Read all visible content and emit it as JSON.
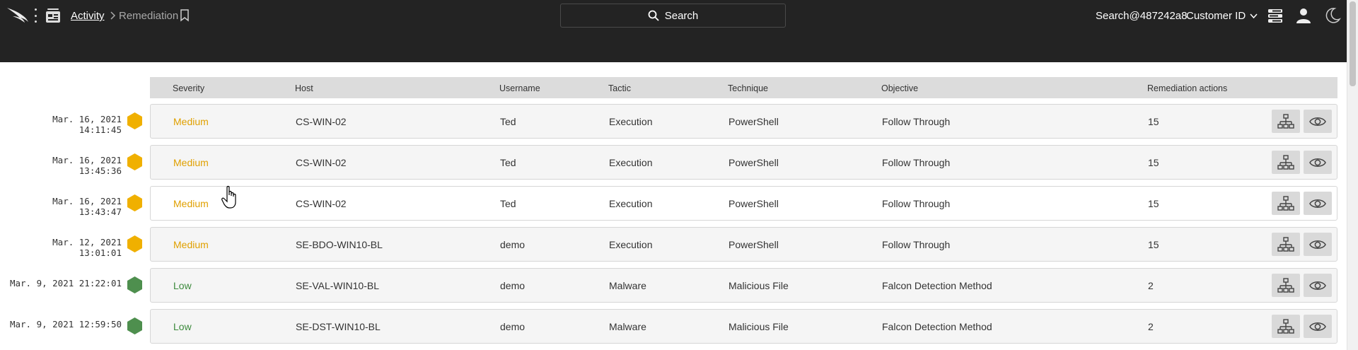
{
  "breadcrumb": {
    "parent": "Activity",
    "current": "Remediation"
  },
  "search": {
    "label": "Search"
  },
  "header": {
    "user": "Search@487242a8",
    "customer": "Customer ID"
  },
  "icons": {
    "logo": "falcon-logo-icon",
    "menu": "vertical-dots-icon",
    "app": "activity-app-icon",
    "bookmark": "bookmark-icon",
    "search": "search-icon",
    "dashboard": "dashboard-icon",
    "profile": "user-icon",
    "theme": "moon-icon",
    "graph": "process-tree-icon",
    "view": "eye-icon"
  },
  "colors": {
    "medium": "#f0b000",
    "low": "#4e8f4e",
    "topbar": "#232323"
  },
  "table": {
    "columns": [
      "Severity",
      "Host",
      "Username",
      "Tactic",
      "Technique",
      "Objective",
      "Remediation actions"
    ],
    "rows": [
      {
        "timestamp": "Mar. 16, 2021 14:11:45",
        "severity": "Medium",
        "host": "CS-WIN-02",
        "username": "Ted",
        "tactic": "Execution",
        "technique": "PowerShell",
        "objective": "Follow Through",
        "actions": "15"
      },
      {
        "timestamp": "Mar. 16, 2021 13:45:36",
        "severity": "Medium",
        "host": "CS-WIN-02",
        "username": "Ted",
        "tactic": "Execution",
        "technique": "PowerShell",
        "objective": "Follow Through",
        "actions": "15"
      },
      {
        "timestamp": "Mar. 16, 2021 13:43:47",
        "severity": "Medium",
        "host": "CS-WIN-02",
        "username": "Ted",
        "tactic": "Execution",
        "technique": "PowerShell",
        "objective": "Follow Through",
        "actions": "15"
      },
      {
        "timestamp": "Mar. 12, 2021 13:01:01",
        "severity": "Medium",
        "host": "SE-BDO-WIN10-BL",
        "username": "demo",
        "tactic": "Execution",
        "technique": "PowerShell",
        "objective": "Follow Through",
        "actions": "15"
      },
      {
        "timestamp": "Mar. 9, 2021 21:22:01",
        "severity": "Low",
        "host": "SE-VAL-WIN10-BL",
        "username": "demo",
        "tactic": "Malware",
        "technique": "Malicious File",
        "objective": "Falcon Detection Method",
        "actions": "2"
      },
      {
        "timestamp": "Mar. 9, 2021 12:59:50",
        "severity": "Low",
        "host": "SE-DST-WIN10-BL",
        "username": "demo",
        "tactic": "Malware",
        "technique": "Malicious File",
        "objective": "Falcon Detection Method",
        "actions": "2"
      }
    ]
  }
}
